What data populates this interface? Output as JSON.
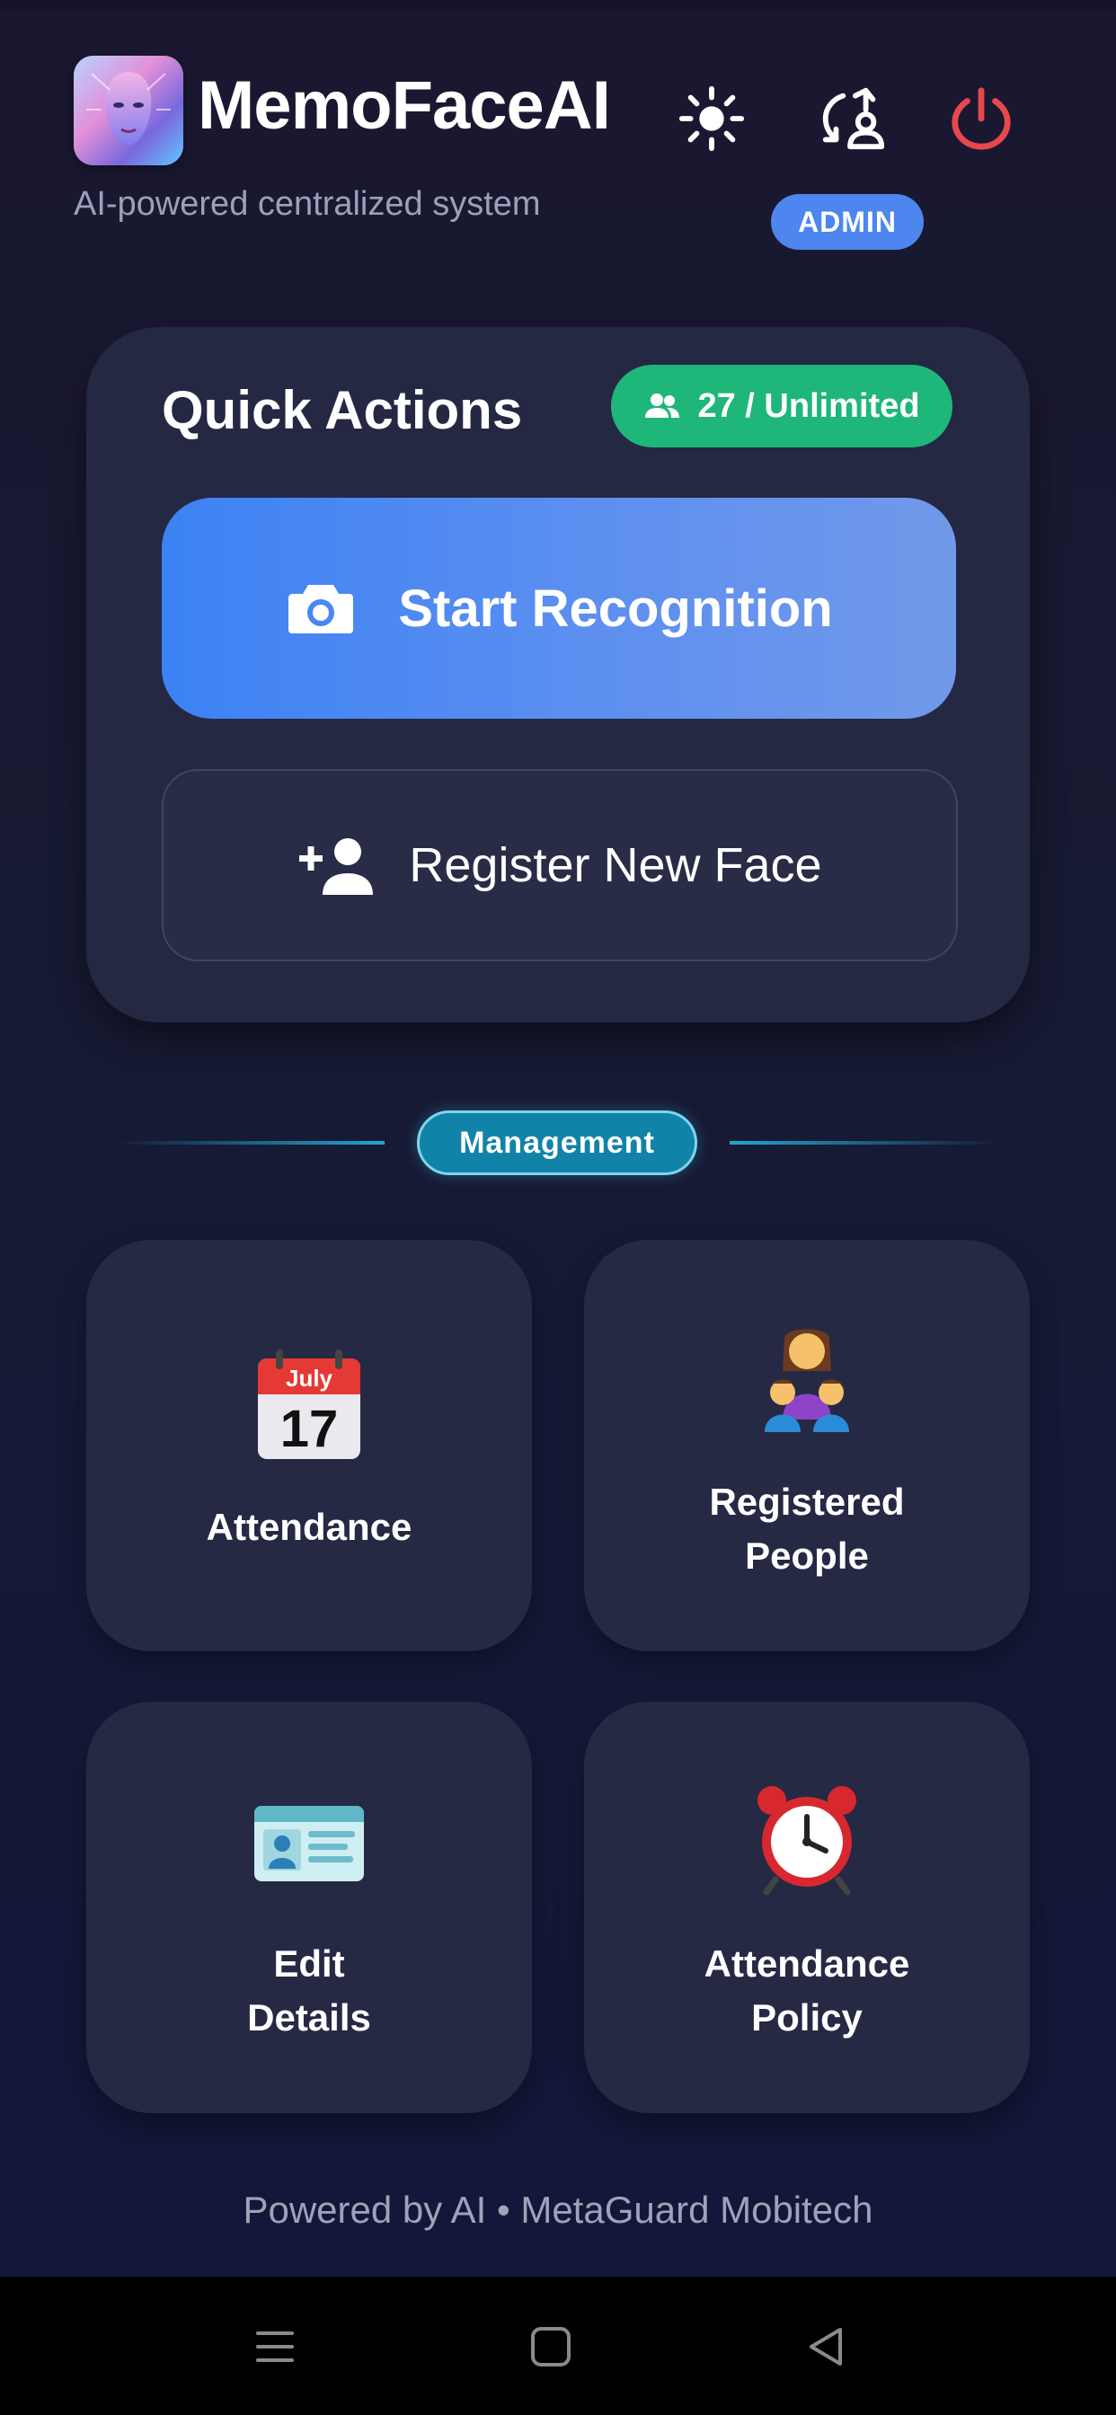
{
  "header": {
    "app_name": "MemoFaceAI",
    "subtitle": "AI-powered centralized system",
    "role_badge": "ADMIN",
    "icons": {
      "theme": "sun-icon",
      "switch": "switch-user-icon",
      "logout": "power-icon"
    },
    "logout_color": "#e5484d"
  },
  "quick_actions": {
    "title": "Quick Actions",
    "quota_label": "27 / Unlimited",
    "quota_icon": "people-icon",
    "start_recognition": {
      "label": "Start Recognition",
      "icon": "camera-icon"
    },
    "register_face": {
      "label": "Register New Face",
      "icon": "add-person-icon"
    }
  },
  "management": {
    "section_label": "Management",
    "tiles": [
      {
        "label_lines": [
          "Attendance"
        ],
        "icon": "calendar-icon",
        "icon_month": "July",
        "icon_day": "17"
      },
      {
        "label_lines": [
          "Registered",
          "People"
        ],
        "icon": "family-icon"
      },
      {
        "label_lines": [
          "Edit",
          "Details"
        ],
        "icon": "id-card-icon"
      },
      {
        "label_lines": [
          "Attendance",
          "Policy"
        ],
        "icon": "alarm-clock-icon"
      }
    ]
  },
  "footer": {
    "text": "Powered by AI • MetaGuard Mobitech"
  },
  "system_nav": {
    "buttons": [
      "menu-icon",
      "home-icon",
      "back-icon"
    ]
  },
  "colors": {
    "accent_blue": "#3c82f4",
    "quota_green": "#1fb67a",
    "management_teal": "#1183a8",
    "card_bg": "#242842"
  }
}
